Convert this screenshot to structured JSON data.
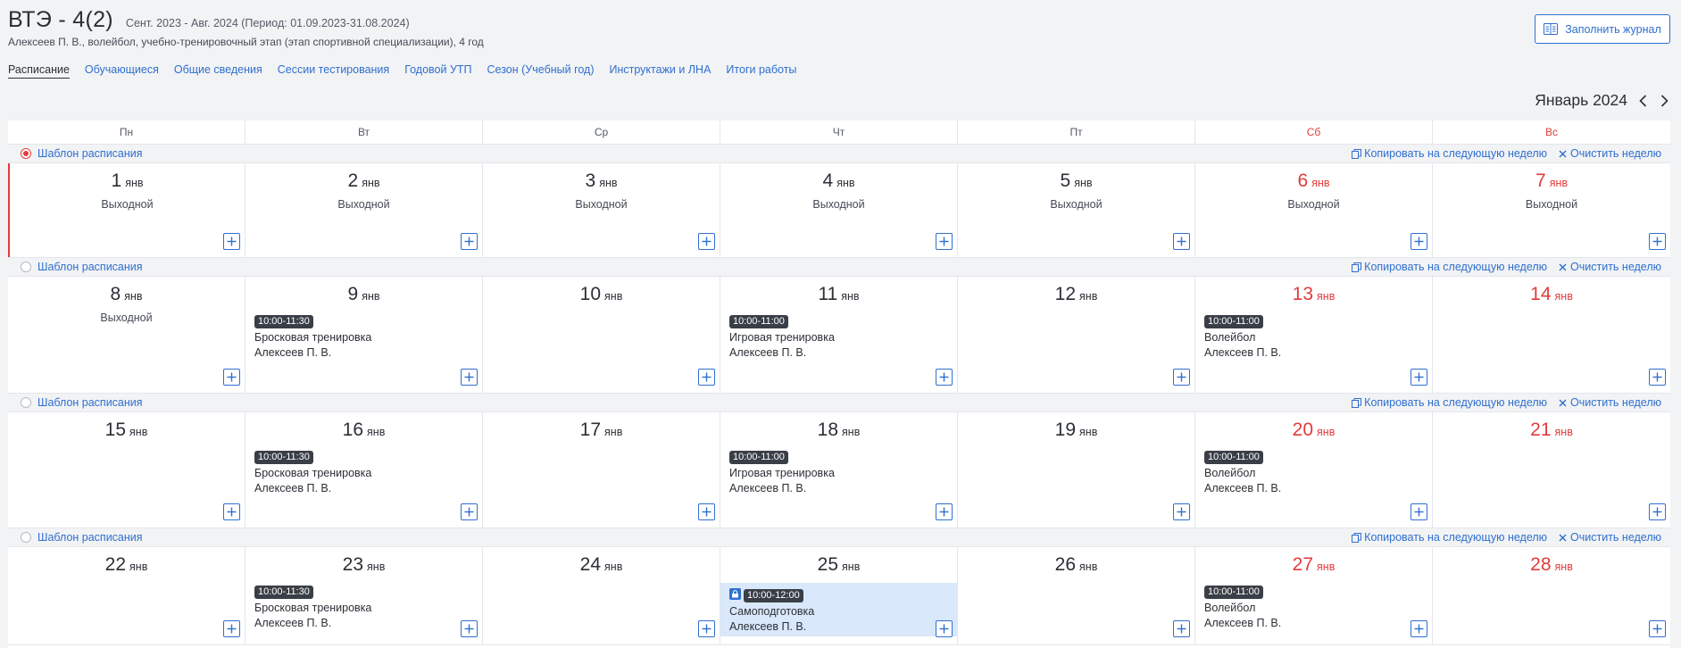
{
  "header": {
    "title": "ВТЭ - 4(2)",
    "period": "Сент. 2023 - Авг. 2024 (Период: 01.09.2023-31.08.2024)",
    "subtitle": "Алексеев П. В., волейбол, учебно-тренировочный этап (этап спортивной специализации), 4 год",
    "journal_button": "Заполнить журнал"
  },
  "tabs": [
    {
      "label": "Расписание"
    },
    {
      "label": "Обучающиеся"
    },
    {
      "label": "Общие сведения"
    },
    {
      "label": "Сессии тестирования"
    },
    {
      "label": "Годовой УТП"
    },
    {
      "label": "Сезон (Учебный год)"
    },
    {
      "label": "Инструктажи и ЛНА"
    },
    {
      "label": "Итоги работы"
    }
  ],
  "calendar": {
    "month_label": "Январь 2024",
    "weekdays": [
      "Пн",
      "Вт",
      "Ср",
      "Чт",
      "Пт",
      "Сб",
      "Вс"
    ],
    "week_bar": {
      "template_label": "Шаблон расписания",
      "copy_label": "Копировать на следующую неделю",
      "clear_label": "Очистить неделю"
    },
    "month_short": "янв",
    "dayoff_label": "Выходной",
    "weeks": [
      {
        "days": [
          {
            "num": "1",
            "dayoff": true
          },
          {
            "num": "2",
            "dayoff": true
          },
          {
            "num": "3",
            "dayoff": true
          },
          {
            "num": "4",
            "dayoff": true
          },
          {
            "num": "5",
            "dayoff": true
          },
          {
            "num": "6",
            "dayoff": true
          },
          {
            "num": "7",
            "dayoff": true
          }
        ]
      },
      {
        "days": [
          {
            "num": "8",
            "dayoff": true
          },
          {
            "num": "9",
            "event": {
              "time": "10:00-11:30",
              "name": "Бросковая тренировка",
              "person": "Алексеев П. В."
            }
          },
          {
            "num": "10"
          },
          {
            "num": "11",
            "event": {
              "time": "10:00-11:00",
              "name": "Игровая тренировка",
              "person": "Алексеев П. В."
            }
          },
          {
            "num": "12"
          },
          {
            "num": "13",
            "event": {
              "time": "10:00-11:00",
              "name": "Волейбол",
              "person": "Алексеев П. В."
            }
          },
          {
            "num": "14"
          }
        ]
      },
      {
        "days": [
          {
            "num": "15"
          },
          {
            "num": "16",
            "event": {
              "time": "10:00-11:30",
              "name": "Бросковая тренировка",
              "person": "Алексеев П. В."
            }
          },
          {
            "num": "17"
          },
          {
            "num": "18",
            "event": {
              "time": "10:00-11:00",
              "name": "Игровая тренировка",
              "person": "Алексеев П. В."
            }
          },
          {
            "num": "19"
          },
          {
            "num": "20",
            "event": {
              "time": "10:00-11:00",
              "name": "Волейбол",
              "person": "Алексеев П. В."
            }
          },
          {
            "num": "21"
          }
        ]
      },
      {
        "days": [
          {
            "num": "22"
          },
          {
            "num": "23",
            "event": {
              "time": "10:00-11:30",
              "name": "Бросковая тренировка",
              "person": "Алексеев П. В."
            }
          },
          {
            "num": "24"
          },
          {
            "num": "25",
            "event": {
              "time": "10:00-12:00",
              "name": "Самоподготовка",
              "person": "Алексеев П. В.",
              "self_study": true
            }
          },
          {
            "num": "26"
          },
          {
            "num": "27",
            "event": {
              "time": "10:00-11:00",
              "name": "Волейбол",
              "person": "Алексеев П. В."
            }
          },
          {
            "num": "28"
          }
        ]
      }
    ]
  },
  "colors": {
    "accent": "#2f6fcf",
    "weekend": "#e23b3b",
    "time_badge": "#3a3f47",
    "self_study_bg": "#d9e8fb"
  }
}
